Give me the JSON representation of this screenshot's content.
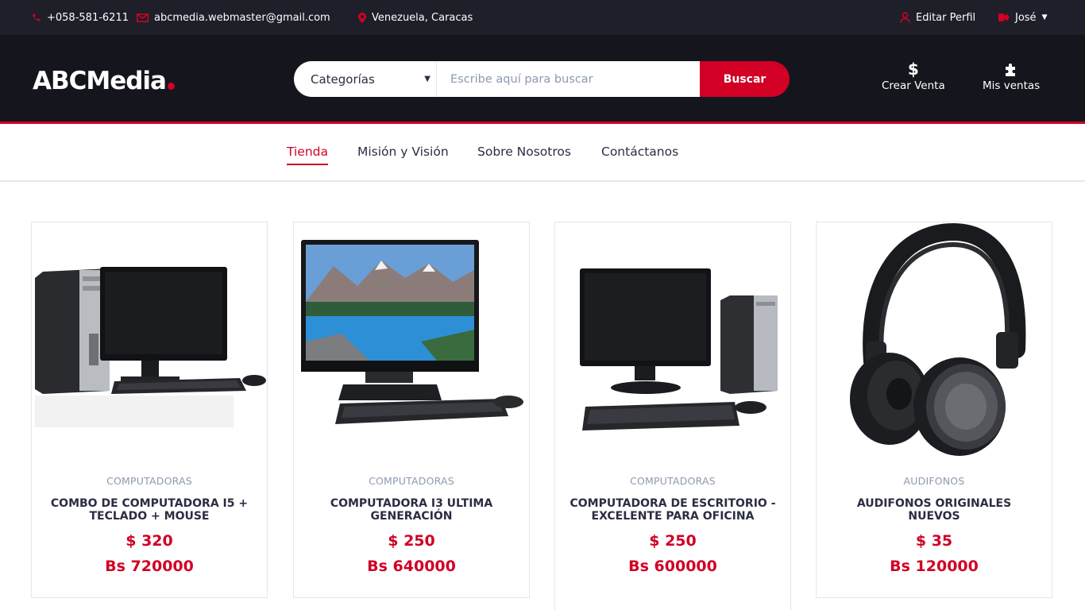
{
  "topbar": {
    "phone": "+058-581-6211",
    "email": "abcmedia.webmaster@gmail.com",
    "location": "Venezuela, Caracas",
    "edit_profile": "Editar Perfil",
    "user_name": "José"
  },
  "header": {
    "logo": "ABCMedia",
    "search": {
      "category_label": "Categorías",
      "placeholder": "Escribe aquí para buscar",
      "button": "Buscar"
    },
    "create_sale": "Crear Venta",
    "my_sales": "Mis ventas"
  },
  "nav": {
    "items": [
      "Tienda",
      "Misión y Visión",
      "Sobre Nosotros",
      "Contáctanos"
    ],
    "active": "Tienda"
  },
  "products": [
    {
      "category": "COMPUTADORAS",
      "name": "COMBO DE COMPUTADORA I5 + TECLADO + MOUSE",
      "price_usd": "$ 320",
      "price_bs": "Bs 720000"
    },
    {
      "category": "COMPUTADORAS",
      "name": "COMPUTADORA I3 ULTIMA GENERACIÓN",
      "price_usd": "$ 250",
      "price_bs": "Bs 640000"
    },
    {
      "category": "COMPUTADORAS",
      "name": "COMPUTADORA DE ESCRITORIO - EXCELENTE PARA OFICINA",
      "price_usd": "$ 250",
      "price_bs": "Bs 600000"
    },
    {
      "category": "AUDIFONOS",
      "name": "AUDIFONOS ORIGINALES NUEVOS",
      "price_usd": "$ 35",
      "price_bs": "Bs 120000"
    }
  ],
  "colors": {
    "accent": "#d10024",
    "topbar_bg": "#1e1f29",
    "header_bg": "#15161d"
  }
}
